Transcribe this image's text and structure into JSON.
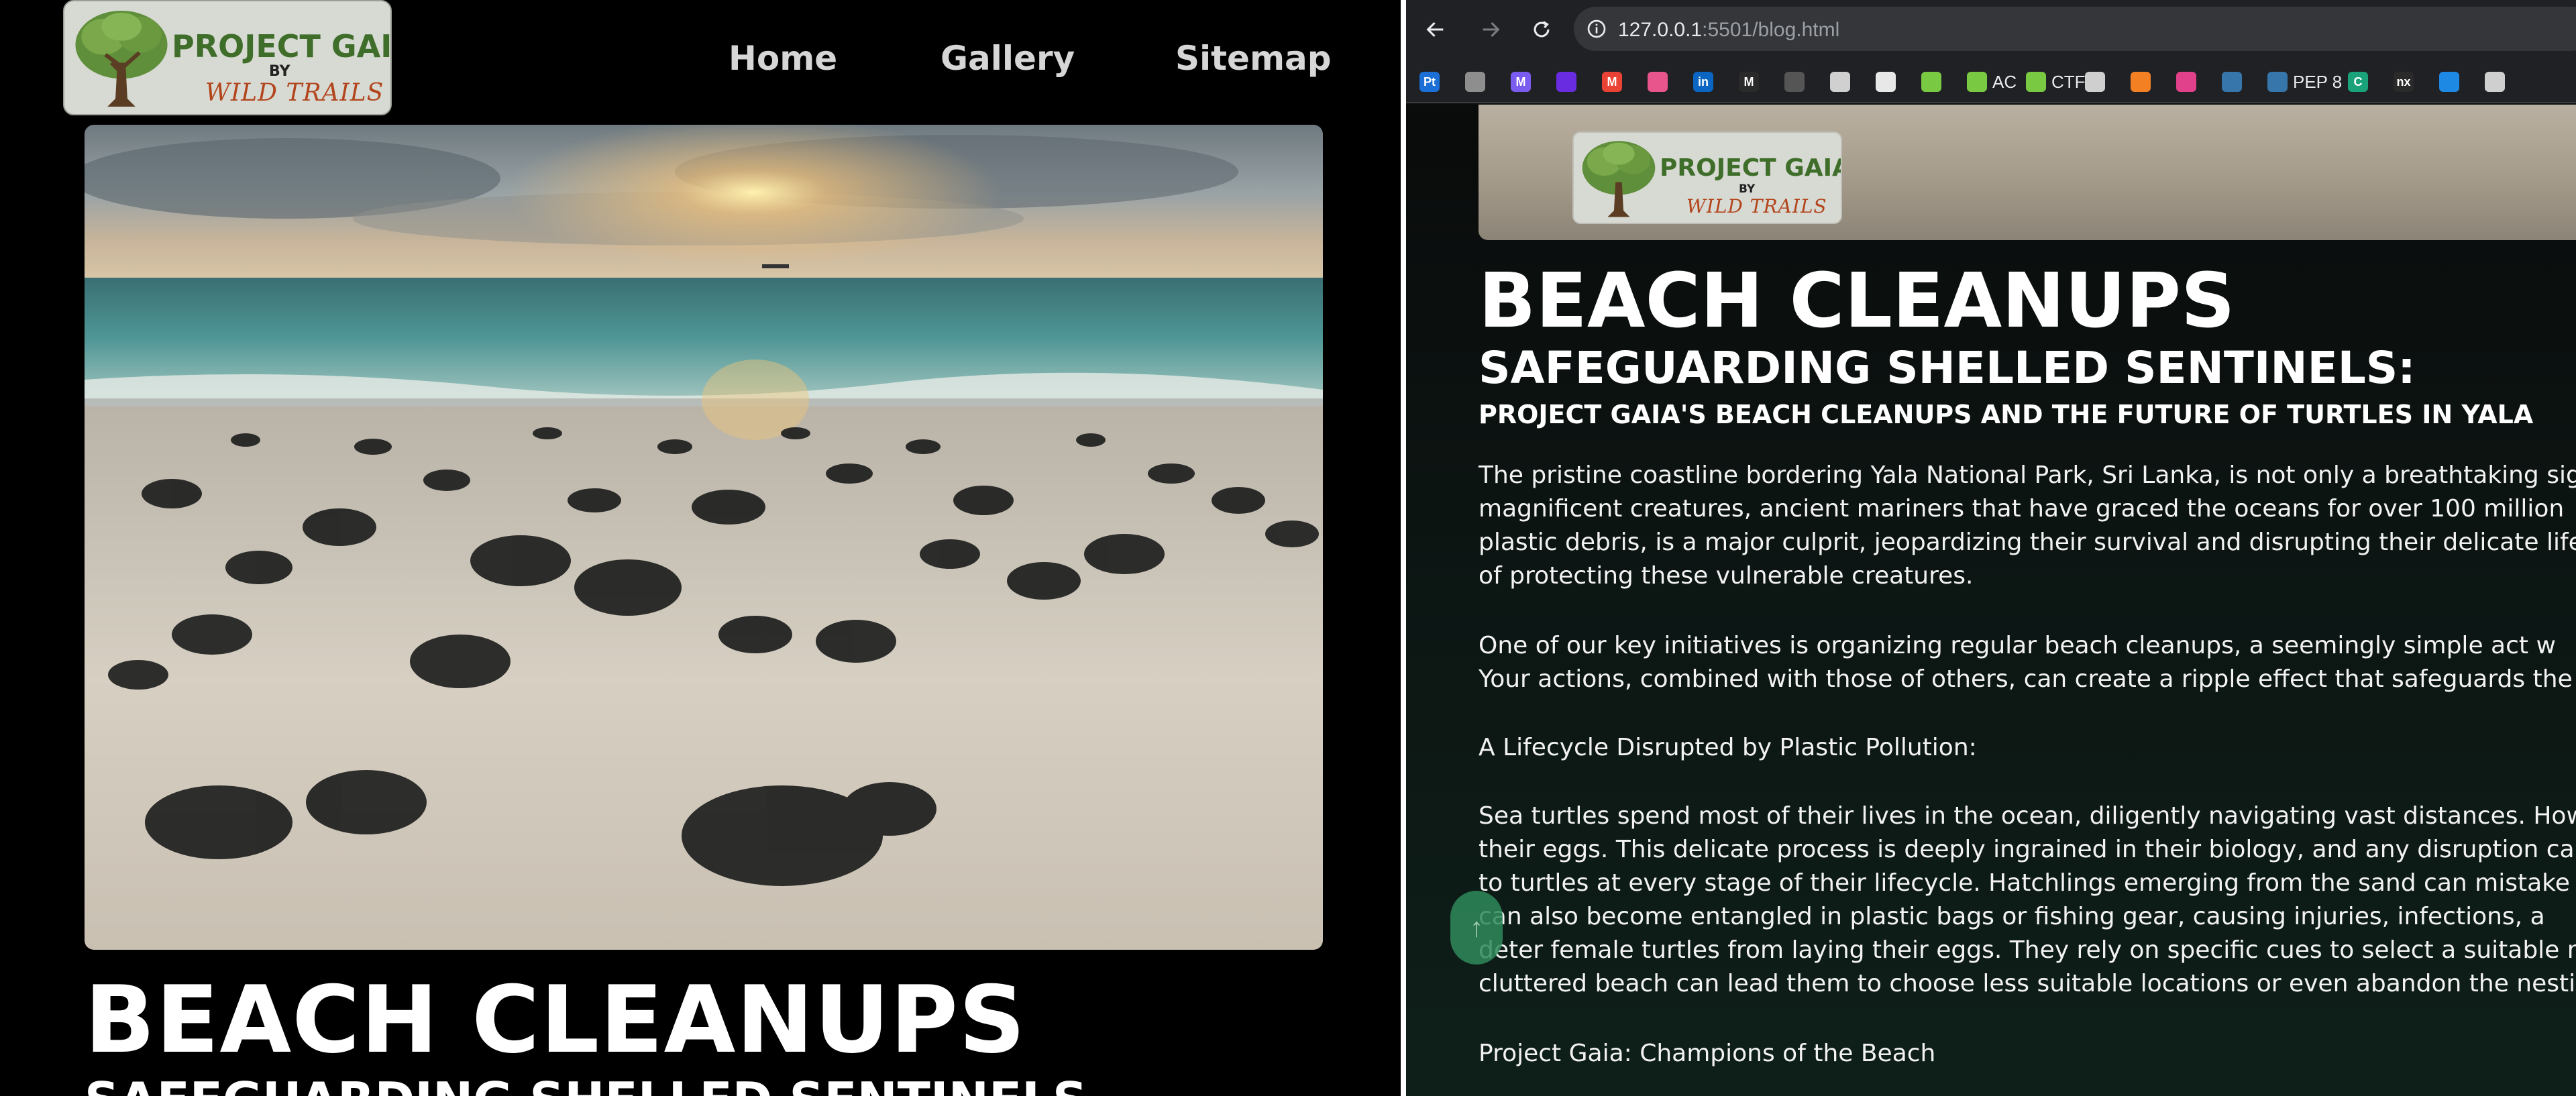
{
  "left_page": {
    "logo": {
      "title": "PROJECT GAIA",
      "by": "BY",
      "subtitle": "WILD TRAILS"
    },
    "nav": {
      "home": "Home",
      "gallery": "Gallery",
      "sitemap": "Sitemap"
    },
    "hero_alt": "Sea turtle hatchlings crawling across sand toward the sea at sunset",
    "heading": "BEACH CLEANUPS",
    "subheading": "SAFEGUARDING SHELLED SENTINELS"
  },
  "browser": {
    "url_host": "127.0.0.1",
    "url_rest": ":5501/blog.html",
    "bookmarks": [
      {
        "icon": "pt-icon",
        "label": "",
        "color": "#1b6fd6",
        "glyph": "Pt"
      },
      {
        "icon": "apple-icon",
        "label": "",
        "color": "#8e8e8e",
        "glyph": ""
      },
      {
        "icon": "mail-icon",
        "label": "",
        "color": "#7b5cf0",
        "glyph": "M"
      },
      {
        "icon": "yahoo-icon",
        "label": "",
        "color": "#6a2ce0",
        "glyph": ""
      },
      {
        "icon": "gmail-icon",
        "label": "",
        "color": "#ea4335",
        "glyph": "M"
      },
      {
        "icon": "colorful-icon",
        "label": "",
        "color": "#e8548c",
        "glyph": ""
      },
      {
        "icon": "linkedin-icon",
        "label": "",
        "color": "#0a66c2",
        "glyph": "in"
      },
      {
        "icon": "mh-icon",
        "label": "",
        "color": "#2a2a2a",
        "glyph": "M"
      },
      {
        "icon": "grid-icon",
        "label": "",
        "color": "#555555",
        "glyph": ""
      },
      {
        "icon": "tri-icon",
        "label": "",
        "color": "#d0d0d0",
        "glyph": ""
      },
      {
        "icon": "github-icon",
        "label": "",
        "color": "#e8e8e8",
        "glyph": ""
      },
      {
        "icon": "cube-icon",
        "label": "",
        "color": "#7ac943",
        "glyph": ""
      },
      {
        "icon": "cube-icon",
        "label": "AC",
        "color": "#7ac943",
        "glyph": ""
      },
      {
        "icon": "cube-icon",
        "label": "CTF",
        "color": "#7ac943",
        "glyph": ""
      },
      {
        "icon": "openai-icon",
        "label": "",
        "color": "#cfcfcf",
        "glyph": ""
      },
      {
        "icon": "stack-icon",
        "label": "",
        "color": "#f48024",
        "glyph": ""
      },
      {
        "icon": "circle-icon",
        "label": "",
        "color": "#e0418a",
        "glyph": ""
      },
      {
        "icon": "python-icon",
        "label": "",
        "color": "#3776ab",
        "glyph": ""
      },
      {
        "icon": "python-icon",
        "label": "PEP 8",
        "color": "#3776ab",
        "glyph": ""
      },
      {
        "icon": "c-icon",
        "label": "",
        "color": "#1aa37a",
        "glyph": "C"
      },
      {
        "icon": "nx-icon",
        "label": "",
        "color": "#2a2a2a",
        "glyph": "nx"
      },
      {
        "icon": "play-icon",
        "label": "",
        "color": "#1e88e5",
        "glyph": ""
      },
      {
        "icon": "openai-icon",
        "label": "",
        "color": "#cfcfcf",
        "glyph": ""
      }
    ]
  },
  "right_page": {
    "logo": {
      "title": "PROJECT GAIA",
      "by": "BY",
      "subtitle": "WILD TRAILS"
    },
    "heading": "BEACH CLEANUPS",
    "subheading": "SAFEGUARDING SHELLED SENTINELS:",
    "subtitle": "PROJECT GAIA'S BEACH CLEANUPS AND THE FUTURE OF TURTLES IN YALA",
    "p1": [
      "The pristine coastline bordering Yala National Park, Sri Lanka, is not only a breathtaking sig",
      "magnificent creatures, ancient mariners that have graced the oceans for over 100 million",
      "plastic debris, is a major culprit, jeopardizing their survival and disrupting their delicate life",
      "of protecting these vulnerable creatures."
    ],
    "p2": [
      "One of our key initiatives is organizing regular beach cleanups, a seemingly simple act w",
      "Your actions, combined with those of others, can create a ripple effect that safeguards the"
    ],
    "p3": "A Lifecycle Disrupted by Plastic Pollution:",
    "p4": [
      "Sea turtles spend most of their lives in the ocean, diligently navigating vast distances. How",
      "their eggs. This delicate process is deeply ingrained in their biology, and any disruption can",
      "to turtles at every stage of their lifecycle. Hatchlings emerging from the sand can mistake",
      "can also become entangled in plastic bags or fishing gear, causing injuries, infections, a",
      "deter female turtles from laying their eggs. They rely on specific cues to select a suitable n",
      "cluttered beach can lead them to choose less suitable locations or even abandon the nesti"
    ],
    "p5": "Project Gaia: Champions of the Beach",
    "scroll_top": "↑"
  }
}
